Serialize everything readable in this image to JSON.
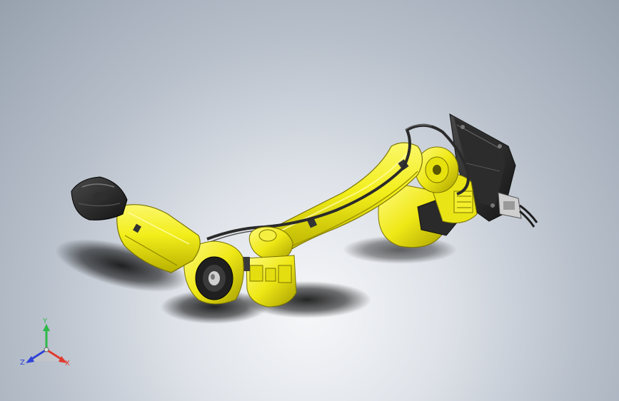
{
  "viewport": {
    "background_top": "#97a1ae",
    "background_center": "#f6f7f9",
    "model_color": "#f2ee1a",
    "dark_part_color": "#232323"
  },
  "triad": {
    "x_label": "X",
    "y_label": "Y",
    "z_label": "Z",
    "x_color": "#e03a2f",
    "y_color": "#2fb84a",
    "z_color": "#2f43d8"
  }
}
